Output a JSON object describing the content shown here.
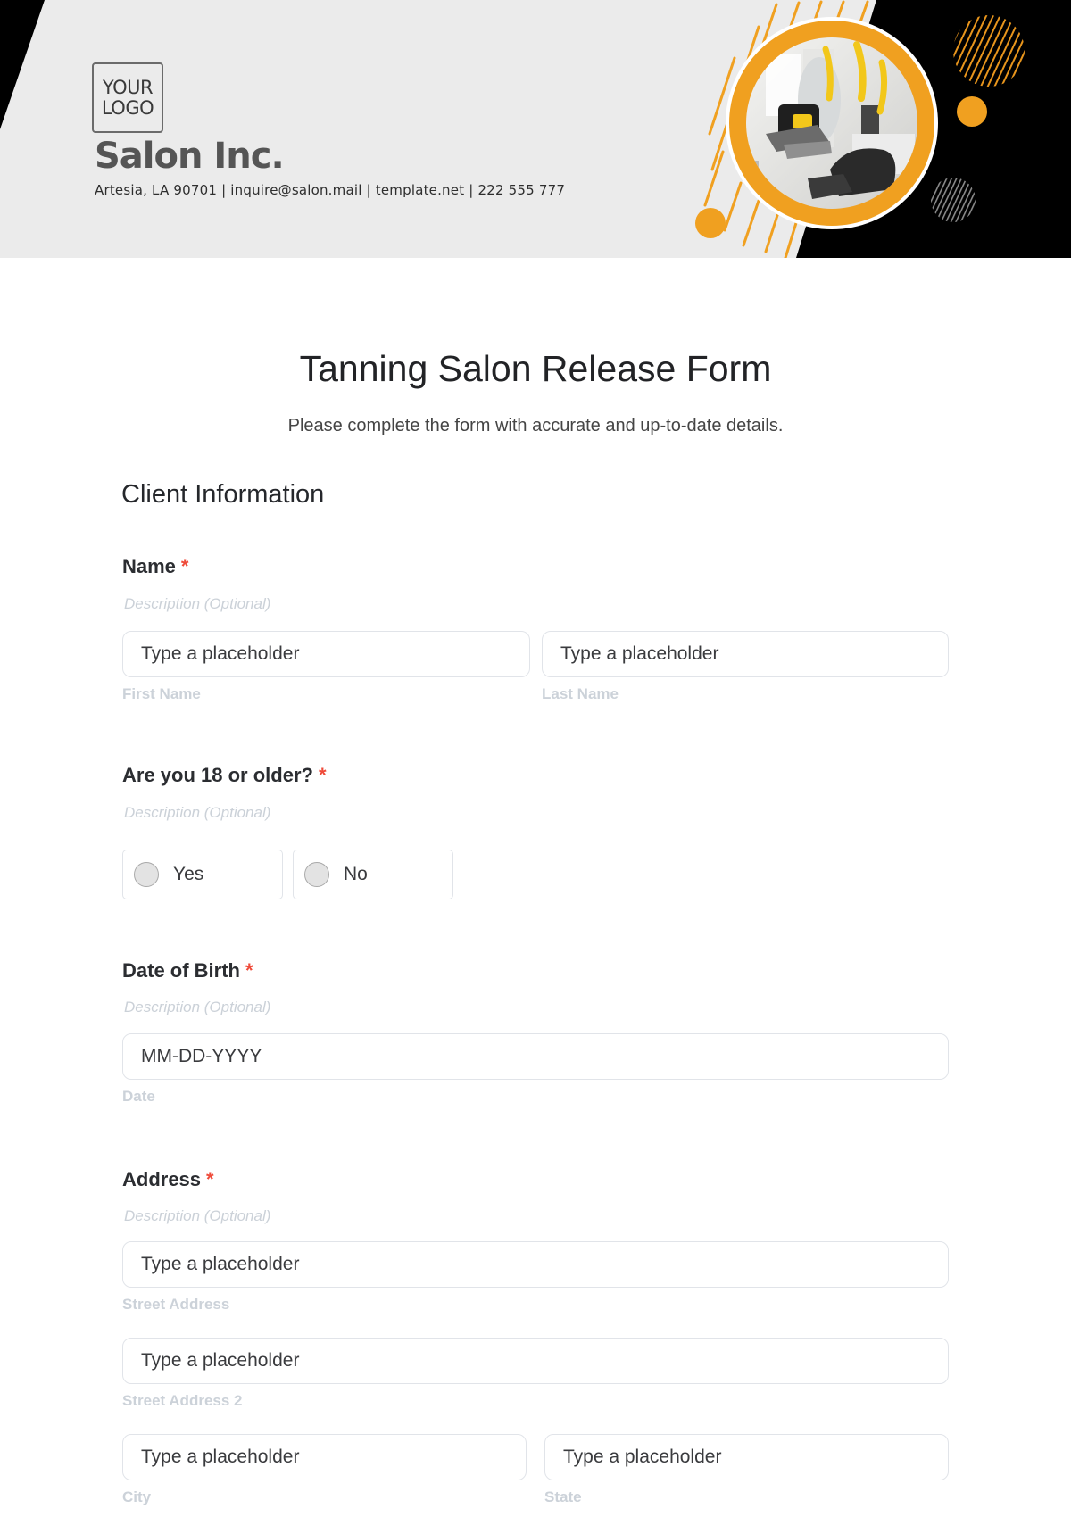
{
  "header": {
    "logo_line1": "YOUR",
    "logo_line2": "LOGO",
    "company_name": "Salon Inc.",
    "contact_line": "Artesia, LA 90701 | inquire@salon.mail | template.net | 222 555 777",
    "colors": {
      "accent": "#f0a020",
      "dark": "#000000",
      "background": "#ebebeb"
    }
  },
  "form": {
    "title": "Tanning Salon Release Form",
    "subtitle": "Please complete the form with accurate and up-to-date details.",
    "section_title": "Client Information",
    "required_marker": "*",
    "fields": {
      "name": {
        "label": "Name",
        "description": "Description (Optional)",
        "first": {
          "placeholder": "Type a placeholder",
          "sublabel": "First Name"
        },
        "last": {
          "placeholder": "Type a placeholder",
          "sublabel": "Last Name"
        }
      },
      "age": {
        "label": "Are you 18 or older?",
        "description": "Description (Optional)",
        "options": [
          "Yes",
          "No"
        ]
      },
      "dob": {
        "label": "Date of Birth",
        "description": "Description (Optional)",
        "placeholder": "MM-DD-YYYY",
        "sublabel": "Date"
      },
      "address": {
        "label": "Address",
        "description": "Description (Optional)",
        "street": {
          "placeholder": "Type a placeholder",
          "sublabel": "Street Address"
        },
        "street2": {
          "placeholder": "Type a placeholder",
          "sublabel": "Street Address 2"
        },
        "city": {
          "placeholder": "Type a placeholder",
          "sublabel": "City"
        },
        "state": {
          "placeholder": "Type a placeholder",
          "sublabel": "State"
        }
      }
    }
  }
}
